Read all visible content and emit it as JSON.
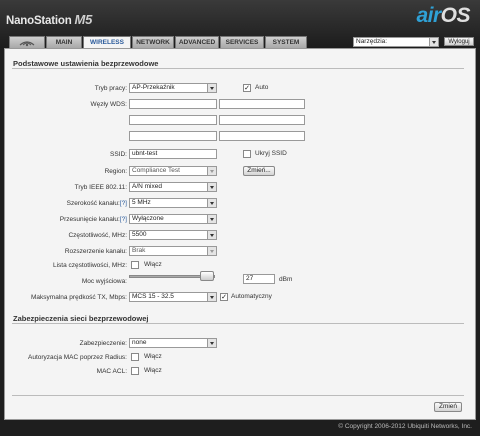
{
  "header": {
    "product": "NanoStation",
    "model": "M5",
    "brand_air": "air",
    "brand_os": "OS"
  },
  "tabs": [
    {
      "label": "",
      "icon": "ubiquiti-logo"
    },
    {
      "label": "MAIN"
    },
    {
      "label": "WIRELESS",
      "active": true
    },
    {
      "label": "NETWORK"
    },
    {
      "label": "ADVANCED"
    },
    {
      "label": "SERVICES"
    },
    {
      "label": "SYSTEM"
    }
  ],
  "tools": {
    "select_value": "Narzędzia:",
    "logout_label": "Wyloguj"
  },
  "basic": {
    "title": "Podstawowe ustawienia bezprzewodowe",
    "mode_label": "Tryb pracy:",
    "mode_value": "AP-Przekaźnik",
    "auto_label": "Auto",
    "auto_checked": true,
    "wds_label": "Węzły WDS:",
    "wds_values": [
      "",
      "",
      "",
      "",
      "",
      ""
    ],
    "ssid_label": "SSID:",
    "ssid_value": "ubnt-test",
    "hide_ssid_label": "Ukryj SSID",
    "hide_ssid_checked": false,
    "region_label": "Region:",
    "region_value": "Compliance Test",
    "change_label": "Zmień...",
    "ieee_label": "Tryb IEEE 802.11:",
    "ieee_value": "A/N mixed",
    "width_label": "Szerokość kanału:",
    "width_help": "[?]",
    "width_value": "5 MHz",
    "shift_label": "Przesunięcie kanału:",
    "shift_help": "[?]",
    "shift_value": "Wyłączone",
    "freq_label": "Częstotliwość, MHz:",
    "freq_value": "5500",
    "ext_label": "Rozszerzenie kanału:",
    "ext_value": "Brak",
    "freqlist_label": "Lista częstotliwości, MHz:",
    "freqlist_enable": "Włącz",
    "freqlist_checked": false,
    "power_label": "Moc wyjściowa:",
    "power_value": "27",
    "power_unit": "dBm",
    "power_slider_fraction": 0.96,
    "rate_label": "Maksymalna prędkość TX, Mbps:",
    "rate_value": "MCS 15 - 32.5",
    "rate_auto_label": "Automatyczny",
    "rate_auto_checked": true
  },
  "security": {
    "title": "Zabezpieczenia sieci bezprzewodowej",
    "sec_label": "Zabezpieczenie:",
    "sec_value": "none",
    "radius_label": "Autoryzacja MAC poprzez Radius:",
    "radius_enable": "Włącz",
    "radius_checked": false,
    "acl_label": "MAC ACL:",
    "acl_enable": "Włącz",
    "acl_checked": false
  },
  "apply_label": "Zmień",
  "footer": {
    "copyright": "© Copyright 2006-2012 Ubiquiti Networks, Inc."
  }
}
